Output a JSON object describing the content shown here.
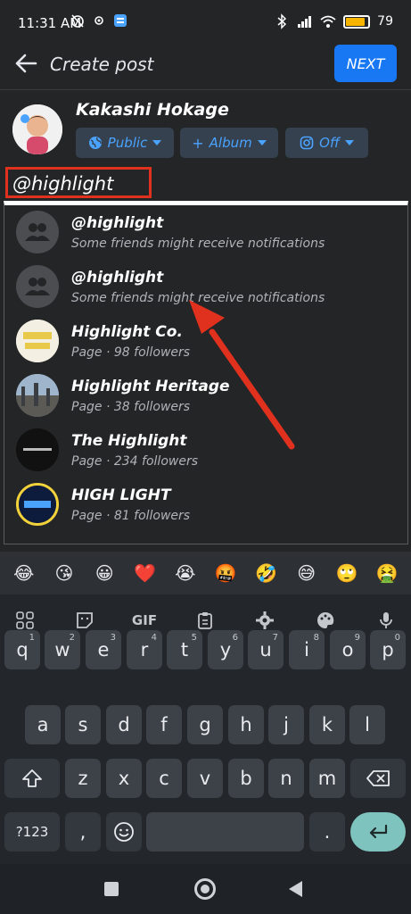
{
  "status_bar": {
    "time": "11:31 AM",
    "battery_pct": "79",
    "battery_level": 0.79
  },
  "header": {
    "title": "Create post",
    "next_label": "NEXT"
  },
  "user": {
    "name": "Kakashi Hokage"
  },
  "audience": {
    "public_label": "Public",
    "album_label": "Album",
    "instagram_label": "Off"
  },
  "post": {
    "text": "@highlight"
  },
  "mentions": [
    {
      "title": "@highlight",
      "subtitle": "Some friends might receive notifications",
      "avatar": "group-icon"
    },
    {
      "title": "@highlight",
      "subtitle": "Some friends might receive notifications",
      "avatar": "group-icon"
    },
    {
      "title": "Highlight Co.",
      "subtitle": "Page · 98 followers",
      "avatar": "page-avatar"
    },
    {
      "title": "Highlight Heritage",
      "subtitle": "Page · 38 followers",
      "avatar": "page-avatar"
    },
    {
      "title": "The Highlight",
      "subtitle": "Page · 234 followers",
      "avatar": "page-avatar"
    },
    {
      "title": "HIGH LIGHT",
      "subtitle": "Page · 81 followers",
      "avatar": "page-avatar"
    }
  ],
  "emojis": [
    "😂",
    "😘",
    "😀",
    "❤️",
    "😭",
    "🤬",
    "🤣",
    "😅",
    "🙄",
    "🤮"
  ],
  "keyboard": {
    "toolbar": {
      "gif_label": "GIF"
    },
    "row1": [
      "q",
      "w",
      "e",
      "r",
      "t",
      "y",
      "u",
      "i",
      "o",
      "p"
    ],
    "row1_hints": [
      "1",
      "2",
      "3",
      "4",
      "5",
      "6",
      "7",
      "8",
      "9",
      "0"
    ],
    "row2": [
      "a",
      "s",
      "d",
      "f",
      "g",
      "h",
      "j",
      "k",
      "l"
    ],
    "row3": [
      "z",
      "x",
      "c",
      "v",
      "b",
      "n",
      "m"
    ],
    "symbols_label": "?123",
    "comma": ",",
    "period": "."
  },
  "colors": {
    "accent": "#1877f2",
    "chip_text": "#4aa3ff",
    "annotation_red": "#e0301e",
    "enter_key": "#7ec3be"
  }
}
